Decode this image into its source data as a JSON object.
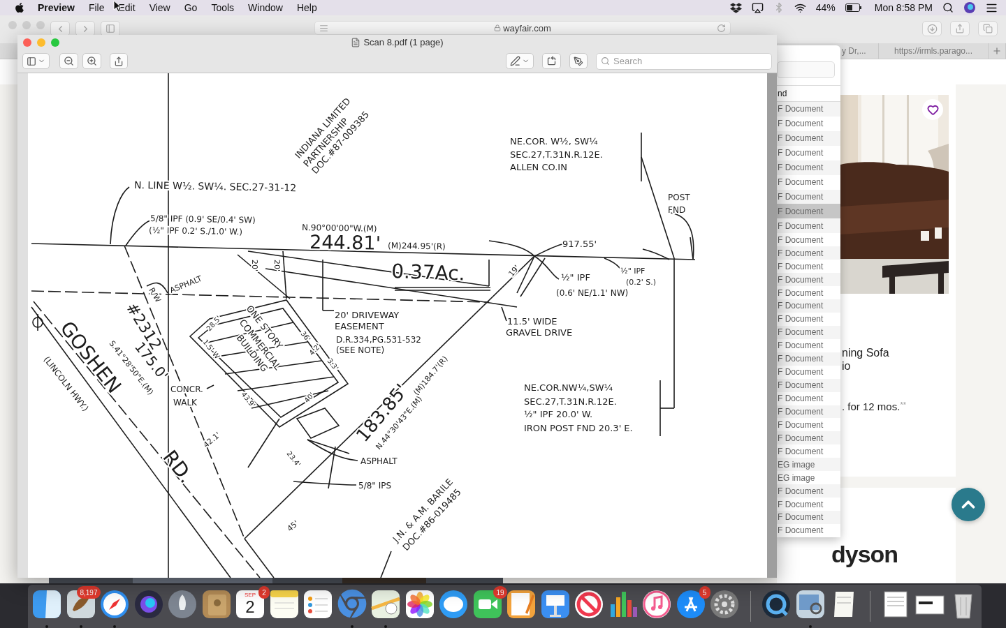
{
  "menu_bar": {
    "app": "Preview",
    "menus": [
      "File",
      "Edit",
      "View",
      "Go",
      "Tools",
      "Window",
      "Help"
    ],
    "battery": "44%",
    "clock": "Mon 8:58 PM"
  },
  "browser": {
    "url": "wayfair.com",
    "tabs": [
      {
        "title": "y Dr,..."
      },
      {
        "title": "https://irmls.parago..."
      }
    ],
    "product": {
      "title_lines": [
        "ning Sofa",
        "io"
      ],
      "offer": ". for 12 mos.",
      "offer_note": "**"
    },
    "brand": "dyson"
  },
  "file_list": {
    "column": "nd",
    "rows": [
      {
        "text": "F Document",
        "selected": false
      },
      {
        "text": "F Document",
        "selected": false
      },
      {
        "text": "F Document",
        "selected": false
      },
      {
        "text": "F Document",
        "selected": false
      },
      {
        "text": "F Document",
        "selected": false
      },
      {
        "text": "F Document",
        "selected": false
      },
      {
        "text": "F Document",
        "selected": false
      },
      {
        "text": "F Document",
        "selected": true
      },
      {
        "text": "F Document",
        "selected": false
      },
      {
        "text": "F Document",
        "selected": false
      },
      {
        "text": "F Document",
        "selected": false
      },
      {
        "text": "F Document",
        "selected": false
      },
      {
        "text": "F Document",
        "selected": false
      },
      {
        "text": "F Document",
        "selected": false
      },
      {
        "text": "F Document",
        "selected": false
      },
      {
        "text": "F Document",
        "selected": false
      },
      {
        "text": "F Document",
        "selected": false
      },
      {
        "text": "F Document",
        "selected": false
      },
      {
        "text": "F Document",
        "selected": false
      },
      {
        "text": "F Document",
        "selected": false
      },
      {
        "text": "F Document",
        "selected": false
      },
      {
        "text": "F Document",
        "selected": false
      },
      {
        "text": "F Document",
        "selected": false
      },
      {
        "text": "F Document",
        "selected": false
      },
      {
        "text": "F Document",
        "selected": false
      },
      {
        "text": "F Document",
        "selected": false
      },
      {
        "text": "EG image",
        "selected": false
      },
      {
        "text": "EG image",
        "selected": false
      },
      {
        "text": "F Document",
        "selected": false
      },
      {
        "text": "F Document",
        "selected": false
      },
      {
        "text": "F Document",
        "selected": false
      },
      {
        "text": "F Document",
        "selected": false
      }
    ]
  },
  "preview": {
    "title": "Scan 8.pdf (1 page)",
    "search": {
      "placeholder": "Search"
    },
    "document": {
      "labels": [
        "INDIANA LIMITED",
        "PARTNERSHIP",
        "DOC.#87-009385",
        "NE.COR. W½, SW¼",
        "SEC.27,T.31N.R.12E.",
        "ALLEN CO.IN",
        "N. LINE W½. SW¼. SEC.27-31-12",
        "POST",
        "FND",
        "5/8\" IPF (0.9' SE/0.4' SW)",
        "(½\" IPF 0.2' S./1.0' W.)",
        "N.90°00'00\"W.(M)",
        "244.81'",
        "(M)244.95'(R)",
        "917.55'",
        "20'",
        "20'",
        "½\" IPF",
        "0.37Ac.",
        "ASPHALT",
        "½\" IPF",
        "19'",
        "(0.2' S.)",
        "R/W",
        "(0.6' NE/1.1' NW)",
        "#2312",
        "20' DRIVEWAY",
        "ONE STORY",
        "11.5' WIDE",
        "GOSHEN",
        "COMMERCIAL",
        "28.5'",
        "EASEMENT",
        "GRAVEL DRIVE",
        "36'",
        "BUILDING",
        "1.5' W",
        "D.R.334,PG.531-532",
        "S.41°28'50\"E.(M)",
        "(SEE NOTE)",
        "4.2'",
        "175.0'",
        "3.3'",
        "(LINCOLN HWY.)",
        "NE.COR.NW¼,SW¼",
        "SEC.27,T.31N.R.12E.",
        "½\" IPF 20.0' W.",
        "IRON POST FND 20.3' E.",
        "CONCR.",
        "43.9'",
        "(M)184.7'(R)",
        "WALK",
        "40'",
        "183.85'",
        "N.44°30'43\"E.(M)",
        "42.1'",
        "23.4'",
        "RD.",
        "ASPHALT",
        "5/8\" IPS",
        "45'",
        "J.N. & A.M. BARILE",
        "DOC.#86-019485"
      ]
    }
  },
  "dock": [
    {
      "kind": "finder",
      "running": true
    },
    {
      "kind": "mail",
      "running": true,
      "badge": "8,197"
    },
    {
      "kind": "safari",
      "running": true
    },
    {
      "kind": "siri",
      "running": false
    },
    {
      "kind": "launchpad",
      "running": false
    },
    {
      "kind": "contacts",
      "running": false
    },
    {
      "kind": "calendar",
      "running": false,
      "badge": "2",
      "month": "SEP",
      "day": "2"
    },
    {
      "kind": "notes",
      "running": false
    },
    {
      "kind": "reminders",
      "running": false
    },
    {
      "kind": "chrome",
      "running": true
    },
    {
      "kind": "maps",
      "running": true
    },
    {
      "kind": "photos",
      "running": false
    },
    {
      "kind": "messages",
      "running": false
    },
    {
      "kind": "facetime",
      "running": false,
      "badge": "19"
    },
    {
      "kind": "pages",
      "running": false
    },
    {
      "kind": "keynote",
      "running": false
    },
    {
      "kind": "news",
      "running": false
    },
    {
      "kind": "numbers",
      "running": false
    },
    {
      "kind": "music",
      "running": false
    },
    {
      "kind": "appstore",
      "running": false,
      "badge": "5"
    },
    {
      "kind": "preferences",
      "running": false
    },
    {
      "kind": "separator"
    },
    {
      "kind": "quicktime",
      "running": false
    },
    {
      "kind": "preview",
      "running": true
    },
    {
      "kind": "textedit",
      "running": false
    },
    {
      "kind": "separator"
    },
    {
      "kind": "document",
      "running": false
    },
    {
      "kind": "screenshot",
      "running": false
    },
    {
      "kind": "trash",
      "running": false
    }
  ]
}
